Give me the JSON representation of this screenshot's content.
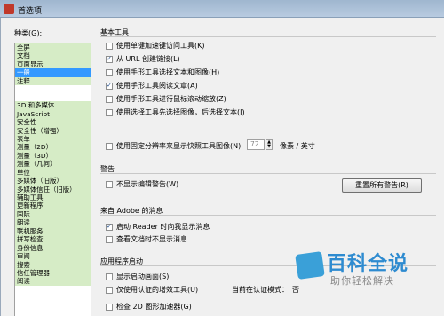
{
  "window": {
    "title": "首选项"
  },
  "categories": {
    "label": "种类(G):",
    "group1": [
      "全屏",
      "文档",
      "页面显示",
      "一般",
      "注释"
    ],
    "group2": [
      "3D 和多媒体",
      "JavaScript",
      "安全性",
      "安全性（增强）",
      "表单",
      "测量（2D）",
      "测量（3D）",
      "测量（几何）",
      "单位",
      "多媒体（旧版）",
      "多媒体信任（旧版）",
      "辅助工具",
      "更新程序",
      "国际",
      "朗读",
      "联机服务",
      "拼写检查",
      "身份信息",
      "审阅",
      "搜索",
      "信任管理器",
      "阅读"
    ],
    "selected": "一般"
  },
  "basic_tools": {
    "title": "基本工具",
    "options": [
      {
        "label": "使用单键加速键访问工具(K)",
        "checked": false
      },
      {
        "label": "从 URL 创建链接(L)",
        "checked": true
      },
      {
        "label": "使用手形工具选择文本和图像(H)",
        "checked": false
      },
      {
        "label": "使用手形工具阅读文章(A)",
        "checked": true
      },
      {
        "label": "使用手形工具进行鼠标滚动缩放(Z)",
        "checked": false
      },
      {
        "label": "使用选择工具先选择图像，后选择文本(I)",
        "checked": false
      }
    ],
    "fixed_resolution": {
      "label": "使用固定分辨率来显示快照工具图像(N)",
      "checked": false,
      "value": "72",
      "unit": "像素 / 英寸"
    }
  },
  "warnings": {
    "title": "警告",
    "no_edit_warning": {
      "label": "不显示编辑警告(W)",
      "checked": false
    },
    "reset_button": "重置所有警告(R)"
  },
  "adobe_messages": {
    "title": "来自 Adobe 的消息",
    "options": [
      {
        "label": "启动 Reader 时向我显示消息",
        "checked": true
      },
      {
        "label": "查看文档时不显示消息",
        "checked": false
      }
    ]
  },
  "startup": {
    "title": "应用程序启动",
    "options": [
      {
        "label": "显示启动画面(S)",
        "checked": false
      },
      {
        "label": "仅使用认证的增效工具(U)",
        "checked": false
      },
      {
        "label": "检查 2D 图形加速器(G)",
        "checked": false
      }
    ],
    "certified_mode_label": "当前在认证模式：",
    "certified_mode_value": "否"
  },
  "watermark": {
    "title": "百科全说",
    "subtitle": "助你轻松解决"
  }
}
